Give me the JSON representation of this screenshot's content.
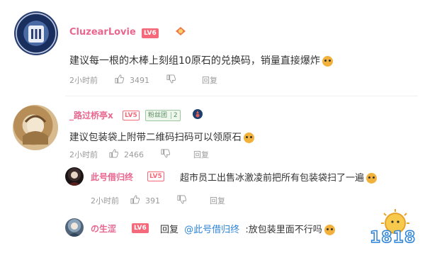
{
  "comments": [
    {
      "user": "CluzearLovie",
      "level": "LV6",
      "text": "建议每一根的木棒上刻组10原石的兑换码，销量直接爆炸",
      "time": "2小时前",
      "likes": "3491",
      "reply_label": "回复"
    },
    {
      "user": "_路过桥亭x",
      "level": "LV5",
      "fan_badge": "粉丝团",
      "fan_level": "2",
      "text": "建议包装袋上附带二维码扫码可以领原石",
      "time": "2小时前",
      "likes": "2466",
      "reply_label": "回复"
    }
  ],
  "replies": [
    {
      "user": "此号借归终",
      "level": "LV5",
      "text": "超市员工出售冰激凌前把所有包装袋扫了一遍",
      "time": "2小时前",
      "likes": "391",
      "reply_label": "回复"
    },
    {
      "user": "の生涩",
      "level": "LV6",
      "reply_prefix": "回复",
      "mention": "@此号借归终",
      "text": ":放包装里面不行吗"
    }
  ],
  "watermark": "1818",
  "colors": {
    "username": "#e8668f",
    "level": "#f46a7a",
    "mention": "#2d84d8"
  }
}
